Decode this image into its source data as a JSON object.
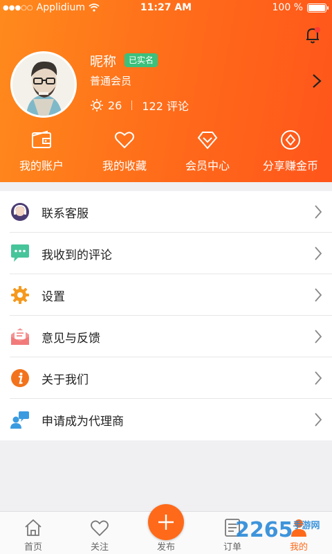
{
  "status_bar": {
    "carrier": "Applidium",
    "signal_icon": "signal-dots-icon",
    "wifi_icon": "wifi-icon",
    "time": "11:27 AM",
    "battery_percent": "100 %",
    "battery_level": 1.0
  },
  "header": {
    "notification_icon": "bell-icon",
    "notification_dot_color": "#ff3b30",
    "nickname": "昵称",
    "verified_badge": "已实名",
    "membership": "普通会员",
    "sun_count": "26",
    "comment_count": "122 评论"
  },
  "quick_actions": [
    {
      "label": "我的账户",
      "icon": "wallet-icon"
    },
    {
      "label": "我的收藏",
      "icon": "heart-icon"
    },
    {
      "label": "会员中心",
      "icon": "diamond-icon"
    },
    {
      "label": "分享赚金币",
      "icon": "coin-icon"
    }
  ],
  "menu": [
    {
      "label": "联系客服",
      "icon": "customer-service-icon"
    },
    {
      "label": "我收到的评论",
      "icon": "comment-bubble-icon"
    },
    {
      "label": "设置",
      "icon": "gear-icon"
    },
    {
      "label": "意见与反馈",
      "icon": "feedback-mail-icon"
    },
    {
      "label": "关于我们",
      "icon": "info-icon"
    },
    {
      "label": "申请成为代理商",
      "icon": "agent-apply-icon"
    }
  ],
  "tabbar": [
    {
      "label": "首页",
      "icon": "home-icon"
    },
    {
      "label": "关注",
      "icon": "heart-outline-icon"
    },
    {
      "label": "发布",
      "icon": "plus-icon"
    },
    {
      "label": "订单",
      "icon": "order-list-icon"
    },
    {
      "label": "我的",
      "icon": "person-icon",
      "active": true
    }
  ],
  "watermark": {
    "main": "2265",
    "sub": "手游网"
  },
  "colors": {
    "accent": "#ff6a1a",
    "badge": "#3cc07b",
    "background": "#f0f0f2"
  }
}
